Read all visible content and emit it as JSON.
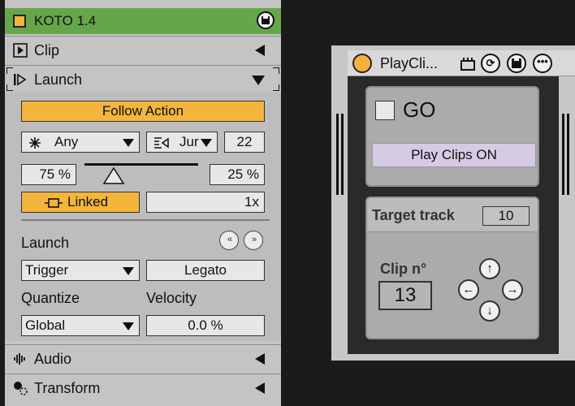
{
  "clip_panel": {
    "title": "KOTO 1.4",
    "sections": {
      "clip": "Clip",
      "launch": "Launch",
      "audio": "Audio",
      "transform": "Transform"
    },
    "follow_action": {
      "label": "Follow Action",
      "action_a": "Any",
      "action_b": "Jur",
      "count": "22",
      "chance_a": "75 %",
      "chance_b": "25 %",
      "linked_label": "Linked",
      "multiplier": "1x"
    },
    "launch_settings": {
      "launch_label": "Launch",
      "mode_value": "Trigger",
      "legato_label": "Legato",
      "quantize_label": "Quantize",
      "velocity_label": "Velocity",
      "quantize_value": "Global",
      "velocity_value": "0.0 %"
    },
    "colors": {
      "title_bar": "#66a64a",
      "accent_orange": "#f3b53c",
      "panel_bg": "#c4c4c4"
    }
  },
  "device": {
    "title": "PlayCli...",
    "go_label": "GO",
    "play_clips_label": "Play Clips ON",
    "target_track_label": "Target track",
    "target_track_value": "10",
    "clip_number_label": "Clip n°",
    "clip_number_value": "13",
    "colors": {
      "led": "#f3b23c",
      "play_button": "#d6cbe4"
    }
  }
}
